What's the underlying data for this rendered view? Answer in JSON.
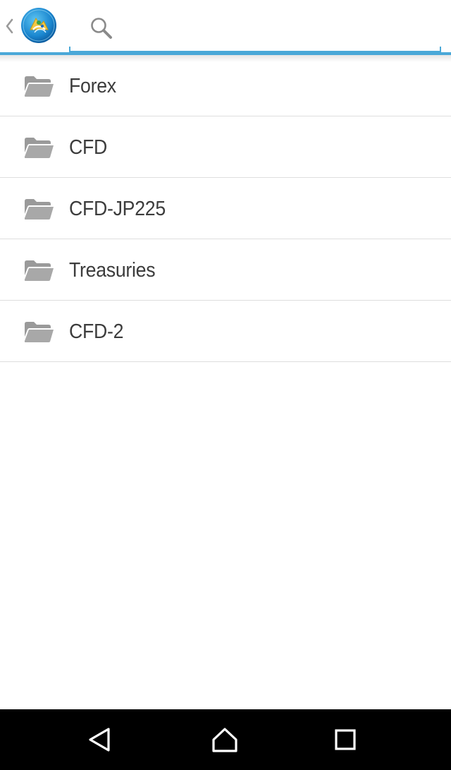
{
  "action_bar": {
    "back_icon": "chevron-left-icon",
    "logo_icon": "metatrader-logo-icon",
    "search": {
      "icon": "search-icon",
      "value": "",
      "placeholder": ""
    },
    "accent_color": "#4aa8d8"
  },
  "folders": [
    {
      "label": "Forex",
      "icon": "folder-open-icon"
    },
    {
      "label": "CFD",
      "icon": "folder-open-icon"
    },
    {
      "label": "CFD-JP225",
      "icon": "folder-open-icon"
    },
    {
      "label": "Treasuries",
      "icon": "folder-open-icon"
    },
    {
      "label": "CFD-2",
      "icon": "folder-open-icon"
    }
  ],
  "navigation_bar": {
    "back": "nav-back-icon",
    "home": "nav-home-icon",
    "recents": "nav-recents-icon"
  },
  "colors": {
    "folder_icon": "#9a9a9a",
    "text": "#3c3c3c",
    "divider": "#dedede",
    "nav_bar": "#000000"
  }
}
